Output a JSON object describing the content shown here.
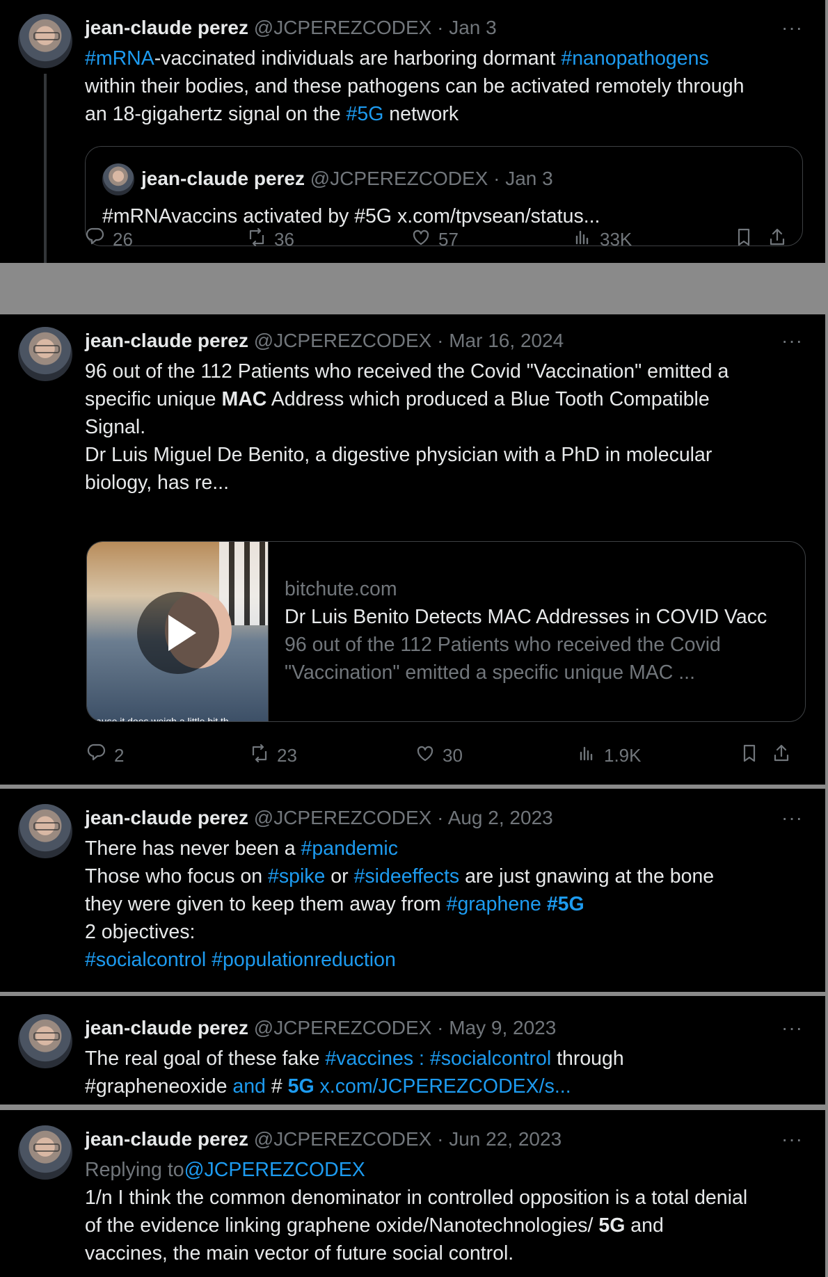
{
  "posts": [
    {
      "name": "jean-claude perez",
      "handle": "@JCPEREZCODEX",
      "date": "Jan 3",
      "lines": [
        [
          {
            "t": "#mRNA",
            "c": "tag"
          },
          {
            "t": "-vaccinated individuals are harboring dormant "
          },
          {
            "t": "#nanopathogens",
            "c": "tag"
          }
        ],
        [
          {
            "t": "within their bodies, and these pathogens can be activated remotely through"
          }
        ],
        [
          {
            "t": "an 18-gigahertz signal on the "
          },
          {
            "t": "#5G",
            "c": "tag"
          },
          {
            "t": " network"
          }
        ]
      ],
      "quote": {
        "name": "jean-claude perez",
        "handle": "@JCPEREZCODEX",
        "date": "Jan 3",
        "text": "#mRNAvaccins activated by #5G x.com/tpvsean/status..."
      },
      "stats": {
        "replies": "26",
        "reposts": "36",
        "likes": "57",
        "views": "33K"
      }
    },
    {
      "name": "jean-claude perez",
      "handle": "@JCPEREZCODEX",
      "date": "Mar 16, 2024",
      "lines": [
        [
          {
            "t": "96 out of the 112 Patients who received the Covid \"Vaccination\" emitted a"
          }
        ],
        [
          {
            "t": "specific unique "
          },
          {
            "t": "MAC",
            "c": "bold"
          },
          {
            "t": " Address which produced a Blue Tooth Compatible"
          }
        ],
        [
          {
            "t": "Signal."
          }
        ],
        [
          {
            "t": " "
          }
        ],
        [
          {
            "t": "Dr Luis Miguel De Benito, a digestive physician with a PhD in molecular"
          }
        ],
        [
          {
            "t": "biology, has re..."
          }
        ]
      ],
      "card": {
        "domain": "bitchute.com",
        "title": "Dr Luis Benito Detects MAC Addresses in COVID Vacc",
        "desc1": "96 out of the 112 Patients who received the Covid",
        "desc2": "\"Vaccination\" emitted a specific unique MAC ...",
        "caption": "cause it does weigh a little bit th"
      },
      "stats": {
        "replies": "2",
        "reposts": "23",
        "likes": "30",
        "views": "1.9K"
      }
    },
    {
      "name": "jean-claude perez",
      "handle": "@JCPEREZCODEX",
      "date": "Aug 2, 2023",
      "lines": [
        [
          {
            "t": "There has never been a "
          },
          {
            "t": "#pandemic",
            "c": "tag"
          }
        ],
        [
          {
            "t": "Those who focus on "
          },
          {
            "t": "#spike",
            "c": "tag"
          },
          {
            "t": " or "
          },
          {
            "t": "#sideeffects",
            "c": "tag"
          },
          {
            "t": " are just gnawing at the bone"
          }
        ],
        [
          {
            "t": "they were given to keep them away from "
          },
          {
            "t": "#graphene",
            "c": "tag"
          },
          {
            "t": " "
          },
          {
            "t": "#5G",
            "c": "tag bold"
          }
        ],
        [
          {
            "t": "2 objectives:"
          }
        ],
        [
          {
            "t": " "
          },
          {
            "t": "#socialcontrol",
            "c": "tag"
          },
          {
            "t": " "
          },
          {
            "t": "#populationreduction",
            "c": "tag"
          }
        ]
      ]
    },
    {
      "name": "jean-claude perez",
      "handle": "@JCPEREZCODEX",
      "date": "May 9, 2023",
      "lines": [
        [
          {
            "t": "The real goal of these fake "
          },
          {
            "t": "#vaccines",
            "c": "tag"
          },
          {
            "t": " : ",
            "c": "tag"
          },
          {
            "t": "#socialcontrol",
            "c": "tag"
          },
          {
            "t": " through"
          }
        ],
        [
          {
            "t": "#grapheneoxide "
          },
          {
            "t": "and",
            "c": "tag"
          },
          {
            "t": " # "
          },
          {
            "t": "5G",
            "c": "tag bold"
          },
          {
            "t": " x.com/JCPEREZCODEX/s...",
            "c": "tag"
          }
        ]
      ]
    },
    {
      "name": "jean-claude perez",
      "handle": "@JCPEREZCODEX",
      "date": "Jun 22, 2023",
      "lines": [
        [
          {
            "t": "Replying to",
            "c": "muted"
          },
          {
            "t": "@JCPEREZCODEX",
            "c": "tag"
          }
        ],
        [
          {
            "t": "1/n I think the common denominator in controlled opposition is a total denial"
          }
        ],
        [
          {
            "t": "of the evidence linking graphene oxide/Nanotechnologies/ "
          },
          {
            "t": "5G",
            "c": "bold"
          },
          {
            "t": " and"
          }
        ],
        [
          {
            "t": "vaccines, the main vector of future social control."
          }
        ]
      ]
    }
  ],
  "icons": {
    "reply": "reply-icon",
    "repost": "repost-icon",
    "like": "heart-icon",
    "views": "views-icon",
    "bookmark": "bookmark-icon",
    "share": "share-icon",
    "more": "more-icon"
  },
  "more_glyph": "···"
}
